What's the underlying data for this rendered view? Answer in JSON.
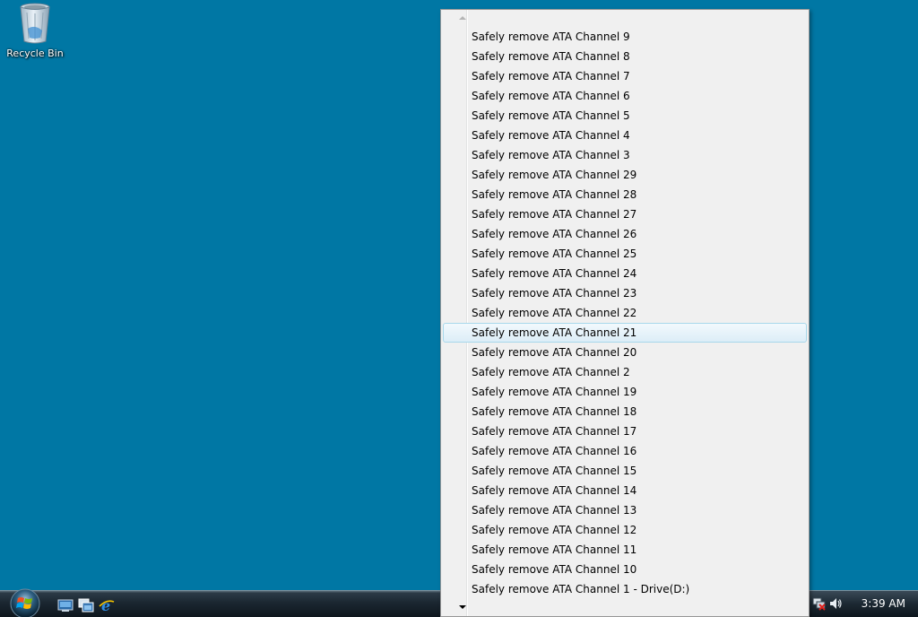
{
  "desktop": {
    "background_color": "#0077a4",
    "icons": [
      {
        "label": "Recycle Bin",
        "icon": "recycle-bin-icon"
      }
    ]
  },
  "taskbar": {
    "start_button_icon": "windows-start-orb-icon",
    "quick_launch": [
      {
        "icon": "show-desktop-icon"
      },
      {
        "icon": "switch-windows-icon"
      },
      {
        "icon": "internet-explorer-icon"
      }
    ],
    "tray_icons": [
      {
        "icon": "network-disconnected-icon"
      },
      {
        "icon": "volume-icon"
      }
    ],
    "clock": "3:39 AM"
  },
  "menu": {
    "scroll_up_icon": "scroll-up-arrow-icon",
    "scroll_down_icon": "scroll-down-arrow-icon",
    "hover_index": 15,
    "hover_border_color": "#a8d8eb",
    "items": [
      "Safely remove ATA Channel 9",
      "Safely remove ATA Channel 8",
      "Safely remove ATA Channel 7",
      "Safely remove ATA Channel 6",
      "Safely remove ATA Channel 5",
      "Safely remove ATA Channel 4",
      "Safely remove ATA Channel 3",
      "Safely remove ATA Channel 29",
      "Safely remove ATA Channel 28",
      "Safely remove ATA Channel 27",
      "Safely remove ATA Channel 26",
      "Safely remove ATA Channel 25",
      "Safely remove ATA Channel 24",
      "Safely remove ATA Channel 23",
      "Safely remove ATA Channel 22",
      "Safely remove ATA Channel 21",
      "Safely remove ATA Channel 20",
      "Safely remove ATA Channel 2",
      "Safely remove ATA Channel 19",
      "Safely remove ATA Channel 18",
      "Safely remove ATA Channel 17",
      "Safely remove ATA Channel 16",
      "Safely remove ATA Channel 15",
      "Safely remove ATA Channel 14",
      "Safely remove ATA Channel 13",
      "Safely remove ATA Channel 12",
      "Safely remove ATA Channel 11",
      "Safely remove ATA Channel 10",
      "Safely remove ATA Channel 1 - Drive(D:)"
    ]
  }
}
